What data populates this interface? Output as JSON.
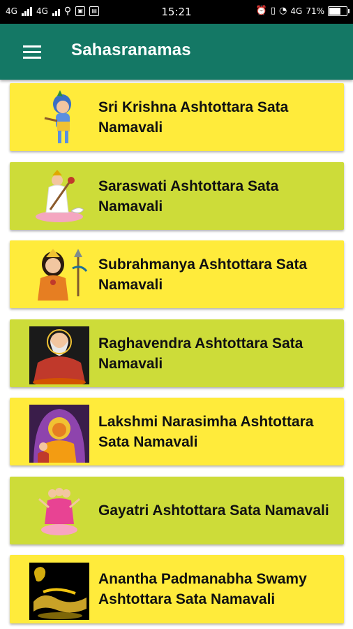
{
  "status_bar": {
    "left": [
      "4G",
      "4G"
    ],
    "time": "15:21",
    "right_network": "4G",
    "battery": "71%",
    "battery_level": 0.71
  },
  "app_bar": {
    "menu_icon": "hamburger-menu-icon",
    "title": "Sahasranamas"
  },
  "items": [
    {
      "label": "Sri Krishna Ashtottara Sata Namavali",
      "thumbnail": "krishna-image",
      "color": "#ffeb3b"
    },
    {
      "label": "Saraswati Ashtottara Sata Namavali",
      "thumbnail": "saraswati-image",
      "color": "#cddc39"
    },
    {
      "label": "Subrahmanya Ashtottara Sata Namavali",
      "thumbnail": "subrahmanya-image",
      "color": "#ffeb3b"
    },
    {
      "label": "Raghavendra Ashtottara Sata Namavali",
      "thumbnail": "raghavendra-image",
      "color": "#cddc39"
    },
    {
      "label": "Lakshmi Narasimha Ashtottara Sata Namavali",
      "thumbnail": "lakshmi-narasimha-image",
      "color": "#ffeb3b"
    },
    {
      "label": "Gayatri Ashtottara Sata Namavali",
      "thumbnail": "gayatri-image",
      "color": "#cddc39"
    },
    {
      "label": "Anantha Padmanabha Swamy Ashtottara Sata Namavali",
      "thumbnail": "anantha-padmanabha-image",
      "color": "#ffeb3b"
    }
  ],
  "colors": {
    "app_bar": "#147865",
    "card_yellow": "#ffeb3b",
    "card_green": "#cddc39"
  }
}
